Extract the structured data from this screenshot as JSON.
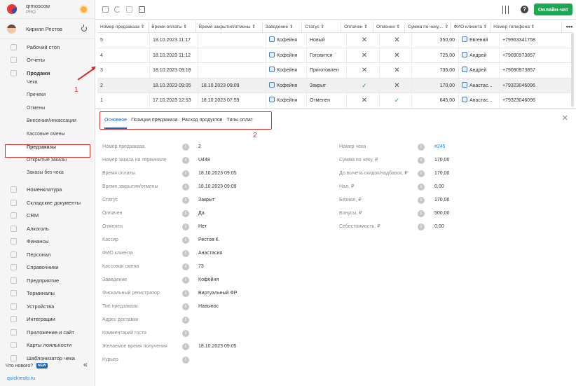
{
  "brand": {
    "name": "qrmoscow",
    "plan": "PRO"
  },
  "user": {
    "name": "Кирилл Рестов"
  },
  "nav": [
    {
      "label": "Рабочий стол",
      "icon": "dashboard-icon",
      "level": 0
    },
    {
      "label": "Отчеты",
      "icon": "reports-icon",
      "level": 0
    },
    {
      "label": "Продажи",
      "icon": "sales-icon",
      "level": 0,
      "bold": true
    },
    {
      "label": "Чеки",
      "level": 1
    },
    {
      "label": "Пречеки",
      "level": 1
    },
    {
      "label": "Отмены",
      "level": 1
    },
    {
      "label": "Внесения/инкассации",
      "level": 1
    },
    {
      "label": "Кассовые смены",
      "level": 1
    },
    {
      "label": "Предзаказы",
      "level": 1,
      "active": true
    },
    {
      "label": "Открытые заказы",
      "level": 1
    },
    {
      "label": "Заказы без чека",
      "level": 1
    },
    {
      "label": "Номенклатура",
      "icon": "nomenclature-icon",
      "level": 0
    },
    {
      "label": "Складские документы",
      "icon": "warehouse-icon",
      "level": 0
    },
    {
      "label": "CRM",
      "icon": "crm-icon",
      "level": 0
    },
    {
      "label": "Алкоголь",
      "icon": "alcohol-icon",
      "level": 0
    },
    {
      "label": "Финансы",
      "icon": "finance-icon",
      "level": 0
    },
    {
      "label": "Персонал",
      "icon": "staff-icon",
      "level": 0
    },
    {
      "label": "Справочники",
      "icon": "directory-icon",
      "level": 0
    },
    {
      "label": "Предприятие",
      "icon": "enterprise-icon",
      "level": 0
    },
    {
      "label": "Терминалы",
      "icon": "terminal-icon",
      "level": 0
    },
    {
      "label": "Устройства",
      "icon": "device-icon",
      "level": 0
    },
    {
      "label": "Интеграции",
      "icon": "integration-icon",
      "level": 0
    },
    {
      "label": "Приложение и сайт",
      "icon": "app-icon",
      "level": 0
    },
    {
      "label": "Карты лояльности",
      "icon": "loyalty-icon",
      "level": 0
    },
    {
      "label": "Шаблонизатор чека",
      "icon": "template-icon",
      "level": 0
    }
  ],
  "whatsnew": {
    "label": "Что нового?",
    "badge": "NEW"
  },
  "site": "quickresto.ru",
  "topbar": {
    "chat_label": "Онлайн-чат",
    "help": "?"
  },
  "table": {
    "columns": [
      "Номер предзаказа ⇕",
      "Время оплаты ⇕",
      "Время закрытия/отмены ⇕",
      "Заведение ⇕",
      "Статус ⇕",
      "Оплачен ⇕",
      "Отменен ⇕",
      "Сумма по чеку,... ⇕",
      "ФИО клиента ⇕",
      "Номер телефона ⇕"
    ],
    "more": "•••",
    "rows": [
      {
        "num": "5",
        "paid_time": "18.10.2023 11:17",
        "closed_time": "",
        "place": "Кофейня",
        "status": "Новый",
        "paid": false,
        "cancelled": false,
        "sum": "350,00",
        "client": "Евгений",
        "phone": "+79963341758"
      },
      {
        "num": "4",
        "paid_time": "18.10.2023 11:12",
        "closed_time": "",
        "place": "Кофейня",
        "status": "Готовится",
        "paid": false,
        "cancelled": false,
        "sum": "725,00",
        "client": "Андрей",
        "phone": "+79090973857"
      },
      {
        "num": "3",
        "paid_time": "18.10.2023 09:18",
        "closed_time": "",
        "place": "Кофейня",
        "status": "Приготовлен",
        "paid": false,
        "cancelled": false,
        "sum": "735,00",
        "client": "Андрей",
        "phone": "+79090973857"
      },
      {
        "num": "2",
        "paid_time": "18.10.2023 09:05",
        "closed_time": "18.10.2023 09:09",
        "place": "Кофейня",
        "status": "Закрыт",
        "paid": true,
        "cancelled": false,
        "sum": "170,00",
        "client": "Анастас...",
        "phone": "+79323046096",
        "selected": true
      },
      {
        "num": "1",
        "paid_time": "17.10.2023 12:53",
        "closed_time": "18.10.2023 07:59",
        "place": "Кофейня",
        "status": "Отменен",
        "paid": false,
        "cancelled": true,
        "sum": "645,00",
        "client": "Анастас...",
        "phone": "+79323046096"
      }
    ]
  },
  "detail": {
    "tabs": [
      "Основное",
      "Позиции предзаказа",
      "Расход продуктов",
      "Типы оплат"
    ],
    "info_glyph": "i",
    "left": [
      {
        "label": "Номер предзаказа",
        "value": "2"
      },
      {
        "label": "Номер заказа на терминале",
        "value": "U448"
      },
      {
        "label": "Время оплаты",
        "value": "18.10.2023 09:05"
      },
      {
        "label": "Время закрытия/отмены",
        "value": "18.10.2023 09:09"
      },
      {
        "label": "Статус",
        "value": "Закрыт"
      },
      {
        "label": "Оплачен",
        "value": "Да"
      },
      {
        "label": "Отменен",
        "value": "Нет"
      },
      {
        "label": "Кассир",
        "value": "Рестов К."
      },
      {
        "label": "ФИО клиента",
        "value": "Анастасия"
      },
      {
        "label": "Кассовая смена",
        "value": "73"
      },
      {
        "label": "Заведение",
        "value": "Кофейня"
      },
      {
        "label": "Фискальный регистратор",
        "value": "Виртуальный ФР"
      },
      {
        "label": "Тип предзаказа",
        "value": "Навынос"
      },
      {
        "label": "Адрес доставки",
        "value": ""
      },
      {
        "label": "Комментарий гостя",
        "value": ""
      },
      {
        "label": "Желаемое время получения",
        "value": "18.10.2023 09:05"
      },
      {
        "label": "Курьер",
        "value": ""
      }
    ],
    "right": [
      {
        "label": "Номер чека",
        "value": "#245",
        "link": true
      },
      {
        "label": "Сумма по чеку, ₽",
        "value": "170,00"
      },
      {
        "label": "До вычета скидок/надбавок, ₽",
        "value": "170,00"
      },
      {
        "label": "Нал, ₽",
        "value": "0,00"
      },
      {
        "label": "Безнал, ₽",
        "value": "170,00"
      },
      {
        "label": "Бонусы, ₽",
        "value": "500,00"
      },
      {
        "label": "Себестоимость, ₽",
        "value": "0,00"
      }
    ]
  },
  "annotations": {
    "one": "1",
    "two": "2"
  },
  "colors": {
    "accent": "#1aa950",
    "annotation": "#d62b2b",
    "link": "#1e88e5"
  }
}
